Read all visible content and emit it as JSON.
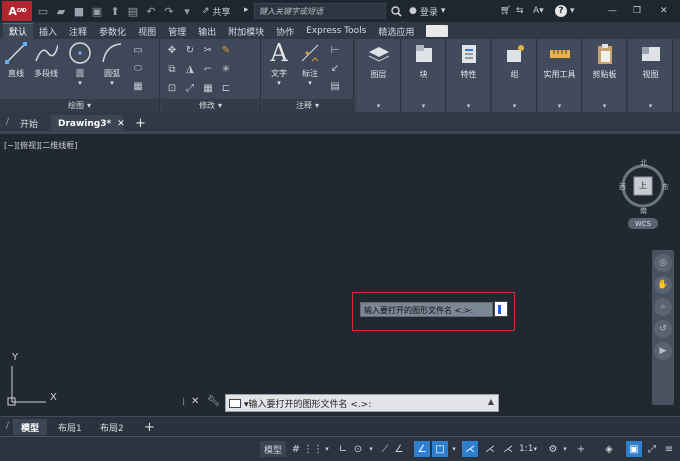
{
  "title_bar": {
    "logo_main": "A",
    "logo_sub": "CAD",
    "share_label": "共享",
    "search_placeholder": "键入关键字或短语",
    "login_label": "登录"
  },
  "ribbon_tabs": [
    "默认",
    "插入",
    "注释",
    "参数化",
    "视图",
    "管理",
    "输出",
    "附加模块",
    "协作",
    "Express Tools",
    "精选应用"
  ],
  "active_tab": "默认",
  "ribbon": {
    "draw": {
      "title": "绘图",
      "line": "直线",
      "polyline": "多段线",
      "circle": "圆",
      "arc": "圆弧"
    },
    "modify": {
      "title": "修改"
    },
    "annotation": {
      "title": "注释",
      "text": "文字",
      "dimension": "标注"
    },
    "layers": "图层",
    "block": "块",
    "properties": "特性",
    "groups": "组",
    "utilities": "实用工具",
    "clipboard": "剪贴板",
    "view": "视图"
  },
  "doc_tabs": {
    "start": "开始",
    "drawing": "Drawing3*"
  },
  "viewport_label": "[−][俯视][二维线框]",
  "viewcube": {
    "north": "北",
    "south": "南",
    "west": "西",
    "east": "东",
    "face": "上",
    "wcs": "WCS"
  },
  "ucs": {
    "y": "Y",
    "x": "X"
  },
  "dynamic_prompt": "输入要打开的图形文件名 <.>:",
  "command_line": "▾输入要打开的图形文件名 <.>:",
  "layout_tabs": [
    "模型",
    "布局1",
    "布局2"
  ],
  "status": {
    "model_label": "模型",
    "scale": "1:1"
  },
  "colors": {
    "brand_red": "#b1252e",
    "canvas": "#212830",
    "ribbon": "#3e4858",
    "highlight_box": "#d32f2f",
    "accent_blue": "#2f7fd1"
  }
}
